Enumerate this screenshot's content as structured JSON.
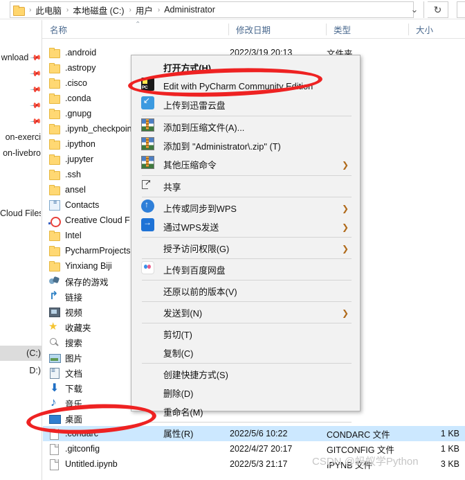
{
  "address_bar": {
    "folder_icon": "folder-icon",
    "breadcrumbs": [
      "此电脑",
      "本地磁盘 (C:)",
      "用户",
      "Administrator"
    ],
    "separator": "›",
    "chevron_icon": "chevron-down-icon",
    "refresh_icon": "refresh-icon",
    "chevron_glyph": "⌄",
    "refresh_glyph": "↻"
  },
  "columns": {
    "name": "名称",
    "date_modified": "修改日期",
    "type": "类型",
    "size": "大小",
    "sort_caret": "⌃"
  },
  "nav_pane": {
    "items": [
      {
        "label": "wnload",
        "pinned": true,
        "selected": false
      },
      {
        "label": "",
        "pinned": true,
        "selected": false
      },
      {
        "label": "",
        "pinned": true,
        "selected": false
      },
      {
        "label": "",
        "pinned": true,
        "selected": false
      },
      {
        "label": "",
        "pinned": true,
        "selected": false
      },
      {
        "label": "on-exerci",
        "pinned": false,
        "selected": false
      },
      {
        "label": "on-livebro",
        "pinned": false,
        "selected": false
      },
      {
        "label": "Cloud Files",
        "pinned": false,
        "selected": false
      },
      {
        "label": "(C:)",
        "pinned": false,
        "selected": true
      },
      {
        "label": "D:)",
        "pinned": false,
        "selected": false
      }
    ],
    "pin_glyph": "📌"
  },
  "file_list": {
    "rows": [
      {
        "name": ".android",
        "icon": "folder-icon",
        "date": "2022/3/19 20:13",
        "type": "文件夹",
        "size": "",
        "selected": false
      },
      {
        "name": ".astropy",
        "icon": "folder-icon",
        "date": "",
        "type": "",
        "size": "",
        "selected": false
      },
      {
        "name": ".cisco",
        "icon": "folder-icon",
        "date": "",
        "type": "",
        "size": "",
        "selected": false
      },
      {
        "name": ".conda",
        "icon": "folder-icon",
        "date": "",
        "type": "",
        "size": "",
        "selected": false
      },
      {
        "name": ".gnupg",
        "icon": "folder-icon",
        "date": "",
        "type": "",
        "size": "",
        "selected": false
      },
      {
        "name": ".ipynb_checkpoint",
        "icon": "folder-icon",
        "date": "",
        "type": "",
        "size": "",
        "selected": false
      },
      {
        "name": ".ipython",
        "icon": "folder-icon",
        "date": "",
        "type": "",
        "size": "",
        "selected": false
      },
      {
        "name": ".jupyter",
        "icon": "folder-icon",
        "date": "",
        "type": "",
        "size": "",
        "selected": false
      },
      {
        "name": ".ssh",
        "icon": "folder-icon",
        "date": "",
        "type": "",
        "size": "",
        "selected": false
      },
      {
        "name": "ansel",
        "icon": "folder-icon",
        "date": "",
        "type": "",
        "size": "",
        "selected": false
      },
      {
        "name": "Contacts",
        "icon": "contacts-icon",
        "date": "",
        "type": "",
        "size": "",
        "selected": false
      },
      {
        "name": "Creative Cloud F",
        "icon": "creative-cloud-icon",
        "date": "",
        "type": "",
        "size": "",
        "selected": false
      },
      {
        "name": "Intel",
        "icon": "folder-icon",
        "date": "",
        "type": "",
        "size": "",
        "selected": false
      },
      {
        "name": "PycharmProjects",
        "icon": "folder-icon",
        "date": "",
        "type": "",
        "size": "",
        "selected": false
      },
      {
        "name": "Yinxiang Biji",
        "icon": "folder-icon",
        "date": "",
        "type": "",
        "size": "",
        "selected": false
      },
      {
        "name": "保存的游戏",
        "icon": "saved-games-icon",
        "date": "",
        "type": "",
        "size": "",
        "selected": false
      },
      {
        "name": "链接",
        "icon": "links-icon",
        "date": "",
        "type": "",
        "size": "",
        "selected": false
      },
      {
        "name": "视频",
        "icon": "videos-icon",
        "date": "",
        "type": "",
        "size": "",
        "selected": false
      },
      {
        "name": "收藏夹",
        "icon": "favorites-icon",
        "date": "",
        "type": "",
        "size": "",
        "selected": false
      },
      {
        "name": "搜索",
        "icon": "searches-icon",
        "date": "",
        "type": "",
        "size": "",
        "selected": false
      },
      {
        "name": "图片",
        "icon": "pictures-icon",
        "date": "",
        "type": "",
        "size": "",
        "selected": false
      },
      {
        "name": "文档",
        "icon": "documents-icon",
        "date": "",
        "type": "",
        "size": "",
        "selected": false
      },
      {
        "name": "下载",
        "icon": "downloads-icon",
        "date": "",
        "type": "",
        "size": "",
        "selected": false
      },
      {
        "name": "音乐",
        "icon": "music-icon",
        "date": "",
        "type": "",
        "size": "",
        "selected": false
      },
      {
        "name": "桌面",
        "icon": "desktop-icon",
        "date": "",
        "type": "",
        "size": "",
        "selected": false
      },
      {
        "name": ".condarc",
        "icon": "file-icon",
        "date": "2022/5/6 10:22",
        "type": "CONDARC 文件",
        "size": "1 KB",
        "selected": true
      },
      {
        "name": ".gitconfig",
        "icon": "file-icon",
        "date": "2022/4/27 20:17",
        "type": "GITCONFIG 文件",
        "size": "1 KB",
        "selected": false
      },
      {
        "name": "Untitled.ipynb",
        "icon": "file-icon",
        "date": "2022/5/3 21:17",
        "type": "IPYNB 文件",
        "size": "3 KB",
        "selected": false
      }
    ]
  },
  "context_menu": {
    "items": [
      {
        "label": "打开方式(H)",
        "icon": "",
        "bold": true,
        "arrow": false
      },
      {
        "label": "Edit with PyCharm Community Edition",
        "icon": "pycharm-icon",
        "bold": false,
        "arrow": false
      },
      {
        "label": "上传到迅雷云盘",
        "icon": "thunder-cloud-icon",
        "bold": false,
        "arrow": false
      },
      {
        "label": "添加到压缩文件(A)...",
        "icon": "winrar-icon",
        "bold": false,
        "arrow": false
      },
      {
        "label": "添加到 \"Administrator\\.zip\" (T)",
        "icon": "winrar-icon",
        "bold": false,
        "arrow": false
      },
      {
        "label": "其他压缩命令",
        "icon": "winrar-icon",
        "bold": false,
        "arrow": true
      },
      {
        "label": "共享",
        "icon": "share-icon",
        "bold": false,
        "arrow": false
      },
      {
        "label": "上传或同步到WPS",
        "icon": "wps-cloud-icon",
        "bold": false,
        "arrow": true
      },
      {
        "label": "通过WPS发送",
        "icon": "wps-send-icon",
        "bold": false,
        "arrow": true
      },
      {
        "label": "授予访问权限(G)",
        "icon": "",
        "bold": false,
        "arrow": true
      },
      {
        "label": "上传到百度网盘",
        "icon": "baidu-netdisk-icon",
        "bold": false,
        "arrow": false
      },
      {
        "label": "还原以前的版本(V)",
        "icon": "",
        "bold": false,
        "arrow": false
      },
      {
        "label": "发送到(N)",
        "icon": "",
        "bold": false,
        "arrow": true
      },
      {
        "label": "剪切(T)",
        "icon": "",
        "bold": false,
        "arrow": false
      },
      {
        "label": "复制(C)",
        "icon": "",
        "bold": false,
        "arrow": false
      },
      {
        "label": "创建快捷方式(S)",
        "icon": "",
        "bold": false,
        "arrow": false
      },
      {
        "label": "删除(D)",
        "icon": "",
        "bold": false,
        "arrow": false
      },
      {
        "label": "重命名(M)",
        "icon": "",
        "bold": false,
        "arrow": false
      },
      {
        "label": "属性(R)",
        "icon": "",
        "bold": false,
        "arrow": false
      }
    ],
    "arrow_glyph": "❯"
  },
  "annotations": {
    "color": "#ee2222",
    "ellipse_1_target": "Edit with PyCharm Community Edition",
    "ellipse_2_target": ".condarc"
  },
  "watermark": {
    "text": "CSDN @蚂蚁学Python"
  }
}
